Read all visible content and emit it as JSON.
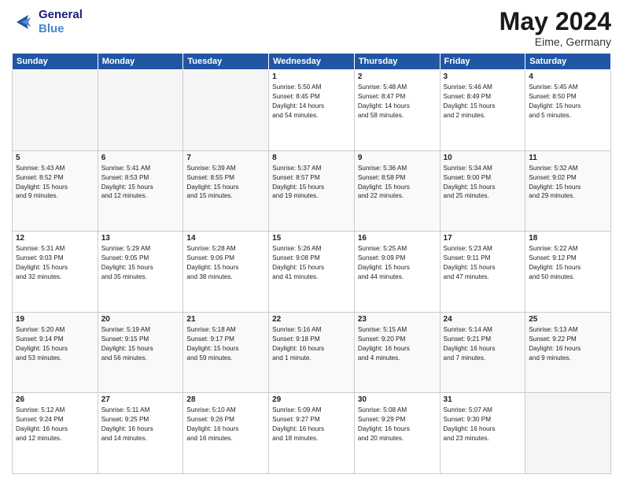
{
  "header": {
    "logo_line1": "General",
    "logo_line2": "Blue",
    "month": "May 2024",
    "location": "Eime, Germany"
  },
  "weekdays": [
    "Sunday",
    "Monday",
    "Tuesday",
    "Wednesday",
    "Thursday",
    "Friday",
    "Saturday"
  ],
  "weeks": [
    [
      {
        "day": "",
        "info": ""
      },
      {
        "day": "",
        "info": ""
      },
      {
        "day": "",
        "info": ""
      },
      {
        "day": "1",
        "info": "Sunrise: 5:50 AM\nSunset: 8:45 PM\nDaylight: 14 hours\nand 54 minutes."
      },
      {
        "day": "2",
        "info": "Sunrise: 5:48 AM\nSunset: 8:47 PM\nDaylight: 14 hours\nand 58 minutes."
      },
      {
        "day": "3",
        "info": "Sunrise: 5:46 AM\nSunset: 8:49 PM\nDaylight: 15 hours\nand 2 minutes."
      },
      {
        "day": "4",
        "info": "Sunrise: 5:45 AM\nSunset: 8:50 PM\nDaylight: 15 hours\nand 5 minutes."
      }
    ],
    [
      {
        "day": "5",
        "info": "Sunrise: 5:43 AM\nSunset: 8:52 PM\nDaylight: 15 hours\nand 9 minutes."
      },
      {
        "day": "6",
        "info": "Sunrise: 5:41 AM\nSunset: 8:53 PM\nDaylight: 15 hours\nand 12 minutes."
      },
      {
        "day": "7",
        "info": "Sunrise: 5:39 AM\nSunset: 8:55 PM\nDaylight: 15 hours\nand 15 minutes."
      },
      {
        "day": "8",
        "info": "Sunrise: 5:37 AM\nSunset: 8:57 PM\nDaylight: 15 hours\nand 19 minutes."
      },
      {
        "day": "9",
        "info": "Sunrise: 5:36 AM\nSunset: 8:58 PM\nDaylight: 15 hours\nand 22 minutes."
      },
      {
        "day": "10",
        "info": "Sunrise: 5:34 AM\nSunset: 9:00 PM\nDaylight: 15 hours\nand 25 minutes."
      },
      {
        "day": "11",
        "info": "Sunrise: 5:32 AM\nSunset: 9:02 PM\nDaylight: 15 hours\nand 29 minutes."
      }
    ],
    [
      {
        "day": "12",
        "info": "Sunrise: 5:31 AM\nSunset: 9:03 PM\nDaylight: 15 hours\nand 32 minutes."
      },
      {
        "day": "13",
        "info": "Sunrise: 5:29 AM\nSunset: 9:05 PM\nDaylight: 15 hours\nand 35 minutes."
      },
      {
        "day": "14",
        "info": "Sunrise: 5:28 AM\nSunset: 9:06 PM\nDaylight: 15 hours\nand 38 minutes."
      },
      {
        "day": "15",
        "info": "Sunrise: 5:26 AM\nSunset: 9:08 PM\nDaylight: 15 hours\nand 41 minutes."
      },
      {
        "day": "16",
        "info": "Sunrise: 5:25 AM\nSunset: 9:09 PM\nDaylight: 15 hours\nand 44 minutes."
      },
      {
        "day": "17",
        "info": "Sunrise: 5:23 AM\nSunset: 9:11 PM\nDaylight: 15 hours\nand 47 minutes."
      },
      {
        "day": "18",
        "info": "Sunrise: 5:22 AM\nSunset: 9:12 PM\nDaylight: 15 hours\nand 50 minutes."
      }
    ],
    [
      {
        "day": "19",
        "info": "Sunrise: 5:20 AM\nSunset: 9:14 PM\nDaylight: 15 hours\nand 53 minutes."
      },
      {
        "day": "20",
        "info": "Sunrise: 5:19 AM\nSunset: 9:15 PM\nDaylight: 15 hours\nand 56 minutes."
      },
      {
        "day": "21",
        "info": "Sunrise: 5:18 AM\nSunset: 9:17 PM\nDaylight: 15 hours\nand 59 minutes."
      },
      {
        "day": "22",
        "info": "Sunrise: 5:16 AM\nSunset: 9:18 PM\nDaylight: 16 hours\nand 1 minute."
      },
      {
        "day": "23",
        "info": "Sunrise: 5:15 AM\nSunset: 9:20 PM\nDaylight: 16 hours\nand 4 minutes."
      },
      {
        "day": "24",
        "info": "Sunrise: 5:14 AM\nSunset: 9:21 PM\nDaylight: 16 hours\nand 7 minutes."
      },
      {
        "day": "25",
        "info": "Sunrise: 5:13 AM\nSunset: 9:22 PM\nDaylight: 16 hours\nand 9 minutes."
      }
    ],
    [
      {
        "day": "26",
        "info": "Sunrise: 5:12 AM\nSunset: 9:24 PM\nDaylight: 16 hours\nand 12 minutes."
      },
      {
        "day": "27",
        "info": "Sunrise: 5:11 AM\nSunset: 9:25 PM\nDaylight: 16 hours\nand 14 minutes."
      },
      {
        "day": "28",
        "info": "Sunrise: 5:10 AM\nSunset: 9:26 PM\nDaylight: 16 hours\nand 16 minutes."
      },
      {
        "day": "29",
        "info": "Sunrise: 5:09 AM\nSunset: 9:27 PM\nDaylight: 16 hours\nand 18 minutes."
      },
      {
        "day": "30",
        "info": "Sunrise: 5:08 AM\nSunset: 9:29 PM\nDaylight: 16 hours\nand 20 minutes."
      },
      {
        "day": "31",
        "info": "Sunrise: 5:07 AM\nSunset: 9:30 PM\nDaylight: 16 hours\nand 23 minutes."
      },
      {
        "day": "",
        "info": ""
      }
    ]
  ]
}
